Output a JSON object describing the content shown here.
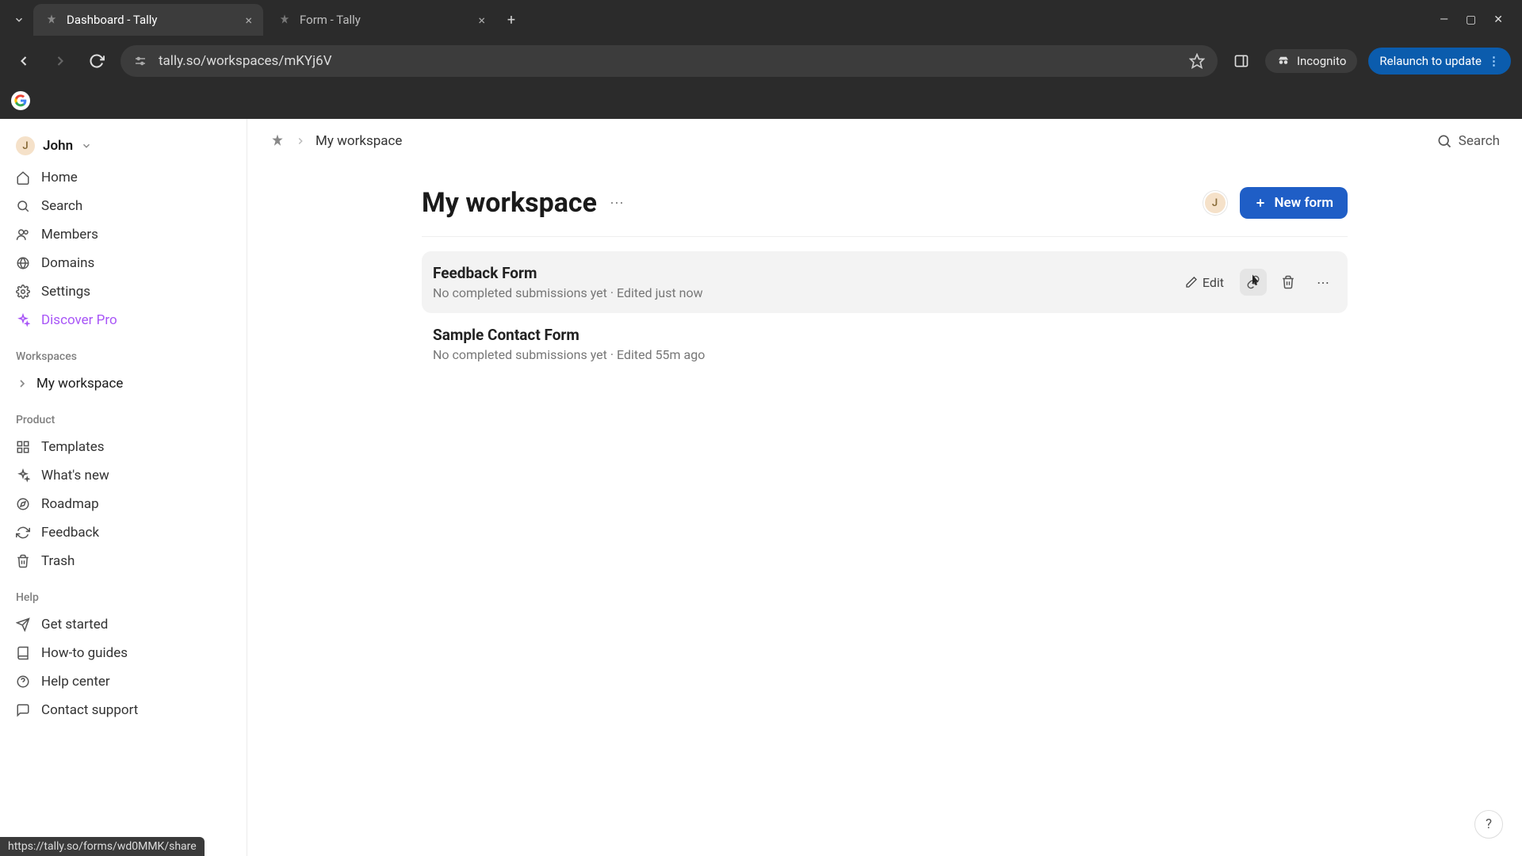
{
  "browser": {
    "tabs": [
      {
        "title": "Dashboard - Tally",
        "active": true
      },
      {
        "title": "Form - Tally",
        "active": false
      }
    ],
    "url": "tally.so/workspaces/mKYj6V",
    "incognito_label": "Incognito",
    "relaunch_label": "Relaunch to update",
    "status_link": "https://tally.so/forms/wd0MMK/share"
  },
  "user": {
    "name": "John",
    "initial": "J"
  },
  "sidebar": {
    "nav": [
      {
        "label": "Home",
        "icon": "home"
      },
      {
        "label": "Search",
        "icon": "search"
      },
      {
        "label": "Members",
        "icon": "users"
      },
      {
        "label": "Domains",
        "icon": "globe"
      },
      {
        "label": "Settings",
        "icon": "gear"
      },
      {
        "label": "Discover Pro",
        "icon": "sparkle",
        "discover": true
      }
    ],
    "workspaces_label": "Workspaces",
    "workspace_name": "My workspace",
    "product_label": "Product",
    "product": [
      {
        "label": "Templates",
        "icon": "grid"
      },
      {
        "label": "What's new",
        "icon": "sparkle"
      },
      {
        "label": "Roadmap",
        "icon": "compass"
      },
      {
        "label": "Feedback",
        "icon": "refresh"
      },
      {
        "label": "Trash",
        "icon": "trash"
      }
    ],
    "help_label": "Help",
    "help": [
      {
        "label": "Get started",
        "icon": "send"
      },
      {
        "label": "How-to guides",
        "icon": "book"
      },
      {
        "label": "Help center",
        "icon": "help"
      },
      {
        "label": "Contact support",
        "icon": "chat"
      }
    ]
  },
  "topbar": {
    "breadcrumb": "My workspace",
    "search_label": "Search"
  },
  "workspace": {
    "title": "My workspace",
    "new_form_label": "New form",
    "member_initial": "J"
  },
  "forms": [
    {
      "title": "Feedback Form",
      "meta": "No completed submissions yet · Edited just now",
      "hovered": true,
      "edit_label": "Edit"
    },
    {
      "title": "Sample Contact Form",
      "meta": "No completed submissions yet · Edited 55m ago",
      "hovered": false
    }
  ]
}
